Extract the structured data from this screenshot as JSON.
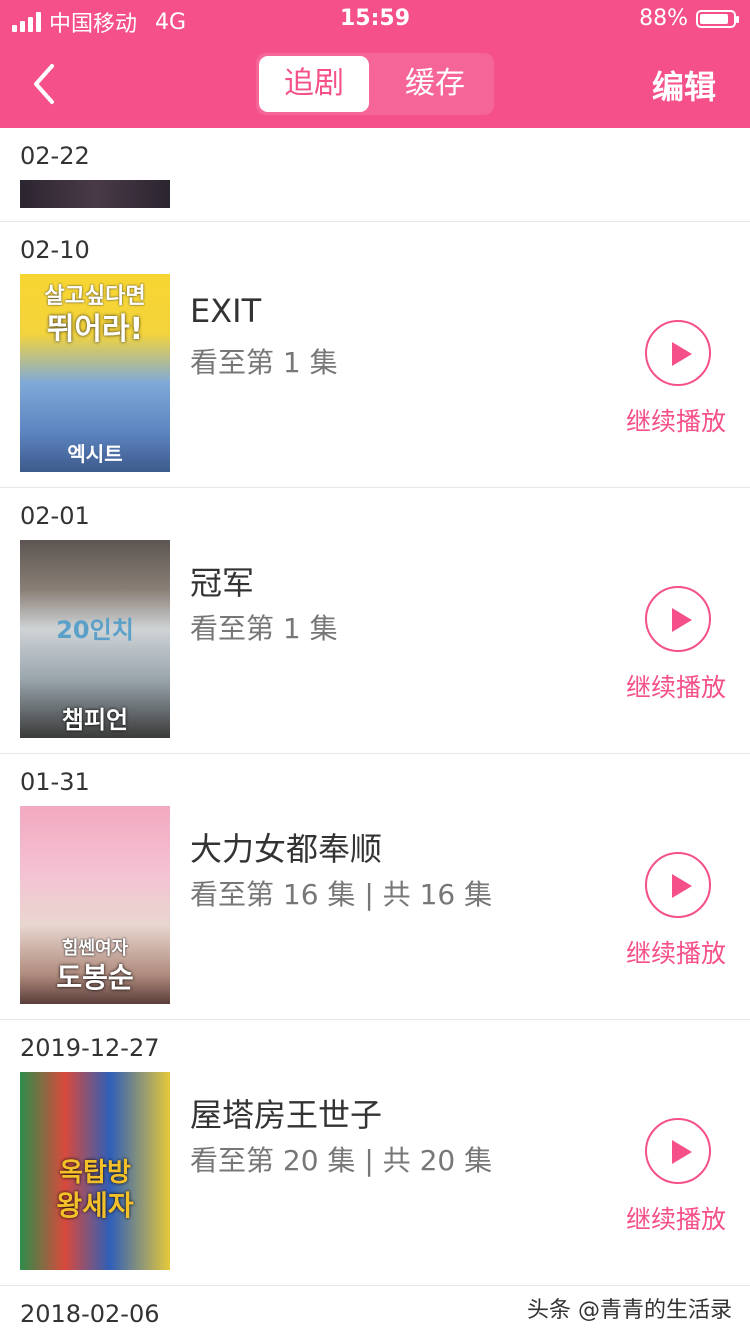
{
  "status_bar": {
    "carrier": "中国移动",
    "network": "4G",
    "time": "15:59",
    "battery_text": "88%",
    "battery_level": 0.88
  },
  "nav": {
    "tabs": [
      {
        "label": "追剧",
        "active": true
      },
      {
        "label": "缓存",
        "active": false
      }
    ],
    "edit_label": "编辑"
  },
  "list": {
    "partial_top": {
      "date": "02-22"
    },
    "items": [
      {
        "date": "02-10",
        "title": "EXIT",
        "progress": "看至第 1 集",
        "action": "继续播放",
        "poster_text": [
          "살고싶다면",
          "뛰어라!",
          "엑시트"
        ]
      },
      {
        "date": "02-01",
        "title": "冠军",
        "progress": "看至第 1 集",
        "action": "继续播放",
        "poster_text": [
          "20인치",
          "챔피언"
        ]
      },
      {
        "date": "01-31",
        "title": "大力女都奉顺",
        "progress": "看至第 16 集 | 共 16 集",
        "action": "继续播放",
        "poster_text": [
          "힘쎈여자",
          "도봉순"
        ]
      },
      {
        "date": "2019-12-27",
        "title": "屋塔房王世子",
        "progress": "看至第 20 集 | 共 20 集",
        "action": "继续播放",
        "poster_text": [
          "옥탑방",
          "왕세자"
        ]
      }
    ],
    "partial_bottom": {
      "date": "2018-02-06"
    }
  },
  "watermark": "头条 @青青的生活录",
  "colors": {
    "accent": "#f5508a"
  }
}
